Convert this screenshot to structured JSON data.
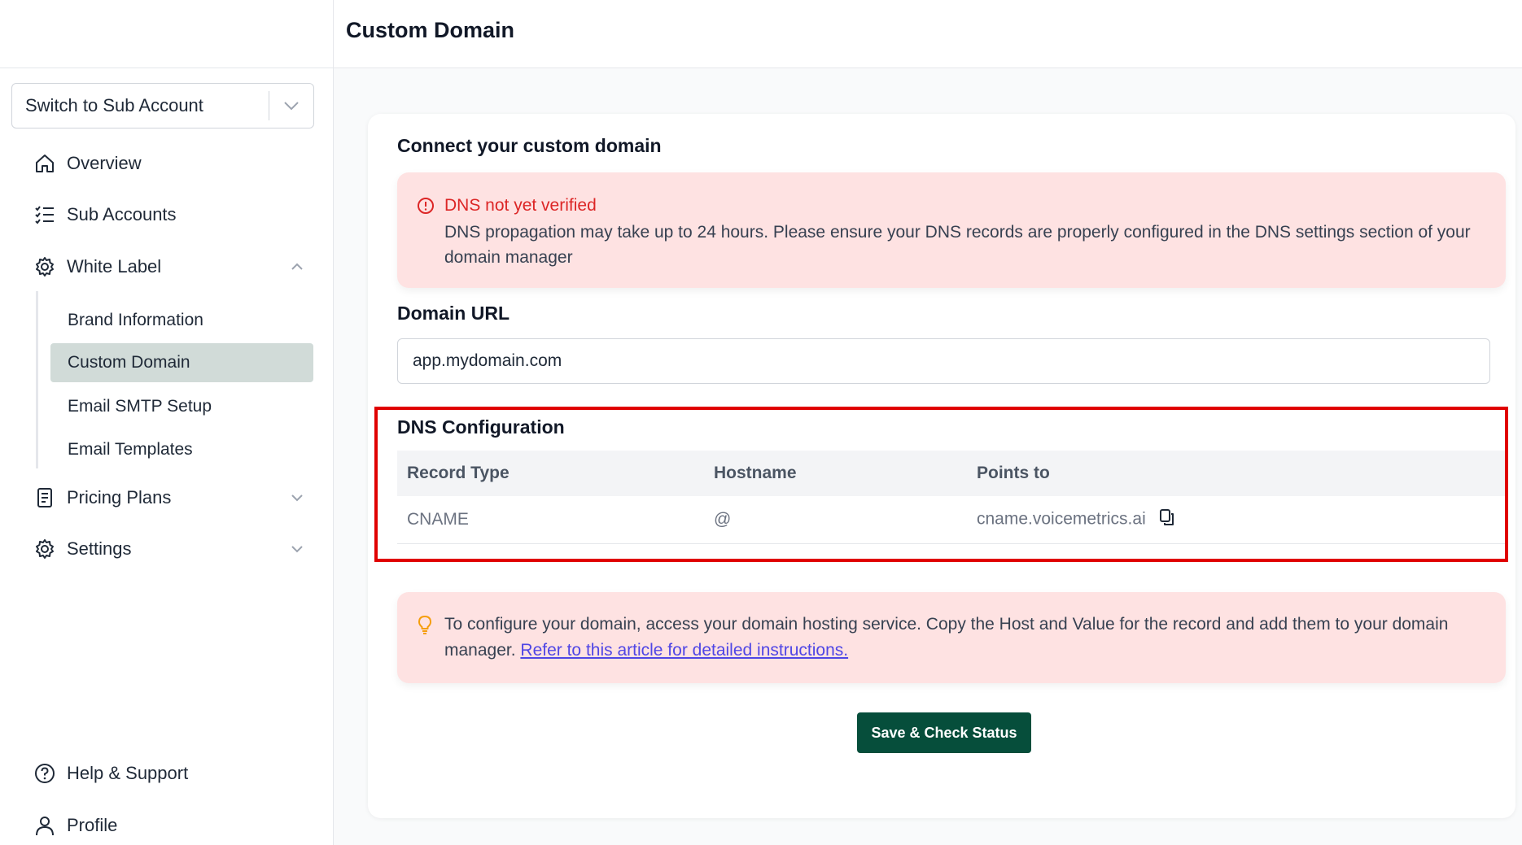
{
  "header": {
    "title": "Custom Domain"
  },
  "sidebar": {
    "switch_account": {
      "label": "Switch to Sub Account"
    },
    "items": [
      {
        "label": "Overview",
        "icon": "home-icon"
      },
      {
        "label": "Sub Accounts",
        "icon": "list-check-icon"
      },
      {
        "label": "White Label",
        "icon": "gear-icon",
        "expanded": true
      },
      {
        "label": "Pricing Plans",
        "icon": "receipt-icon"
      },
      {
        "label": "Settings",
        "icon": "gear-icon"
      }
    ],
    "white_label_sub": [
      {
        "label": "Brand Information"
      },
      {
        "label": "Custom Domain",
        "active": true
      },
      {
        "label": "Email SMTP Setup"
      },
      {
        "label": "Email Templates"
      }
    ],
    "bottom": [
      {
        "label": "Help & Support",
        "icon": "help-circle-icon"
      },
      {
        "label": "Profile",
        "icon": "user-icon"
      }
    ]
  },
  "main": {
    "connect_heading": "Connect your custom domain",
    "alert": {
      "title": "DNS not yet verified",
      "text": "DNS propagation may take up to 24 hours. Please ensure your DNS records are properly configured in the DNS settings section of your domain manager"
    },
    "domain_url": {
      "label": "Domain URL",
      "value": "app.mydomain.com"
    },
    "dns": {
      "heading": "DNS Configuration",
      "columns": [
        "Record Type",
        "Hostname",
        "Points to"
      ],
      "rows": [
        {
          "record_type": "CNAME",
          "hostname": "@",
          "points_to": "cname.voicemetrics.ai"
        }
      ]
    },
    "tip": {
      "text": "To configure your domain, access your domain hosting service. Copy the Host and Value for the record and add them to your domain manager.",
      "link_text": "Refer to this article for detailed instructions."
    },
    "save_button": "Save & Check Status"
  },
  "colors": {
    "accent": "#064e3b",
    "alert_bg": "#fee2e2",
    "alert_title": "#dc2626",
    "link": "#4f46e5",
    "highlight": "#e00000",
    "active_nav_bg": "#d1dbd8"
  }
}
